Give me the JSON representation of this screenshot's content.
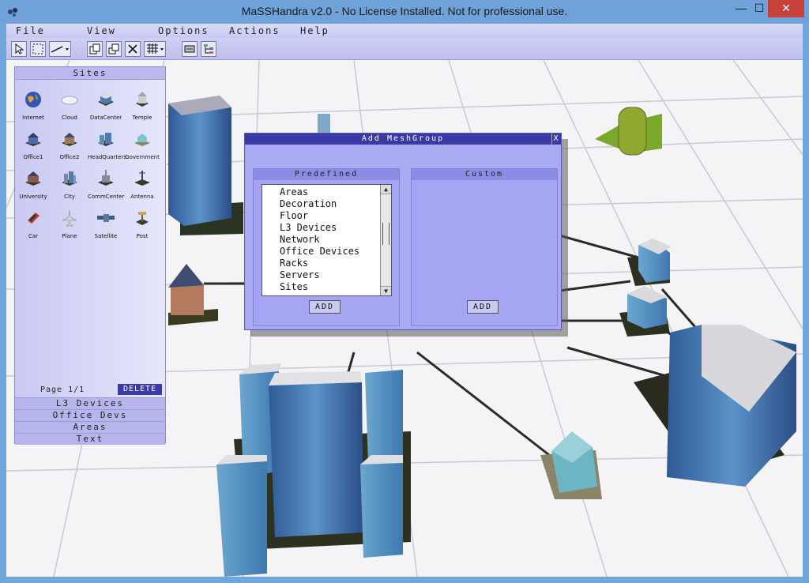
{
  "window": {
    "title": "MaSSHandra v2.0 - No License Installed. Not for professional use.",
    "minimize": "—",
    "maximize": "☐",
    "close": "✕"
  },
  "menu": [
    "File",
    "View",
    "Options",
    "Actions",
    "Help"
  ],
  "toolbar": [
    "select-icon",
    "marquee-select-icon",
    "line-tool-icon",
    "copy-icon",
    "paste-icon",
    "delete-icon",
    "grid-icon",
    "refresh-icon",
    "tree-icon"
  ],
  "sites_panel": {
    "title": "Sites",
    "items": [
      {
        "label": "Internet",
        "icon": "globe-icon"
      },
      {
        "label": "Cloud",
        "icon": "cloud-icon"
      },
      {
        "label": "DataCenter",
        "icon": "datacenter-icon"
      },
      {
        "label": "Temple",
        "icon": "temple-icon"
      },
      {
        "label": "Office1",
        "icon": "office1-icon"
      },
      {
        "label": "Office2",
        "icon": "office2-icon"
      },
      {
        "label": "HeadQuarters",
        "icon": "headquarters-icon"
      },
      {
        "label": "Government",
        "icon": "government-icon"
      },
      {
        "label": "University",
        "icon": "university-icon"
      },
      {
        "label": "City",
        "icon": "city-icon"
      },
      {
        "label": "CommCenter",
        "icon": "commcenter-icon"
      },
      {
        "label": "Antenna",
        "icon": "antenna-icon"
      },
      {
        "label": "Car",
        "icon": "car-icon"
      },
      {
        "label": "Plane",
        "icon": "plane-icon"
      },
      {
        "label": "Satellite",
        "icon": "satellite-icon"
      },
      {
        "label": "Post",
        "icon": "post-icon"
      }
    ],
    "page": "Page  1/1",
    "delete": "DELETE",
    "categories": [
      "L3 Devices",
      "Office Devs",
      "Areas",
      "Text"
    ]
  },
  "dialog": {
    "title": "Add MeshGroup",
    "close": "X",
    "predefined": {
      "title": "Predefined",
      "items": [
        "Areas",
        "Decoration",
        "Floor",
        "L3 Devices",
        "Network",
        "Office Devices",
        "Racks",
        "Servers",
        "Sites"
      ],
      "add": "ADD"
    },
    "custom": {
      "title": "Custom",
      "add": "ADD"
    }
  }
}
